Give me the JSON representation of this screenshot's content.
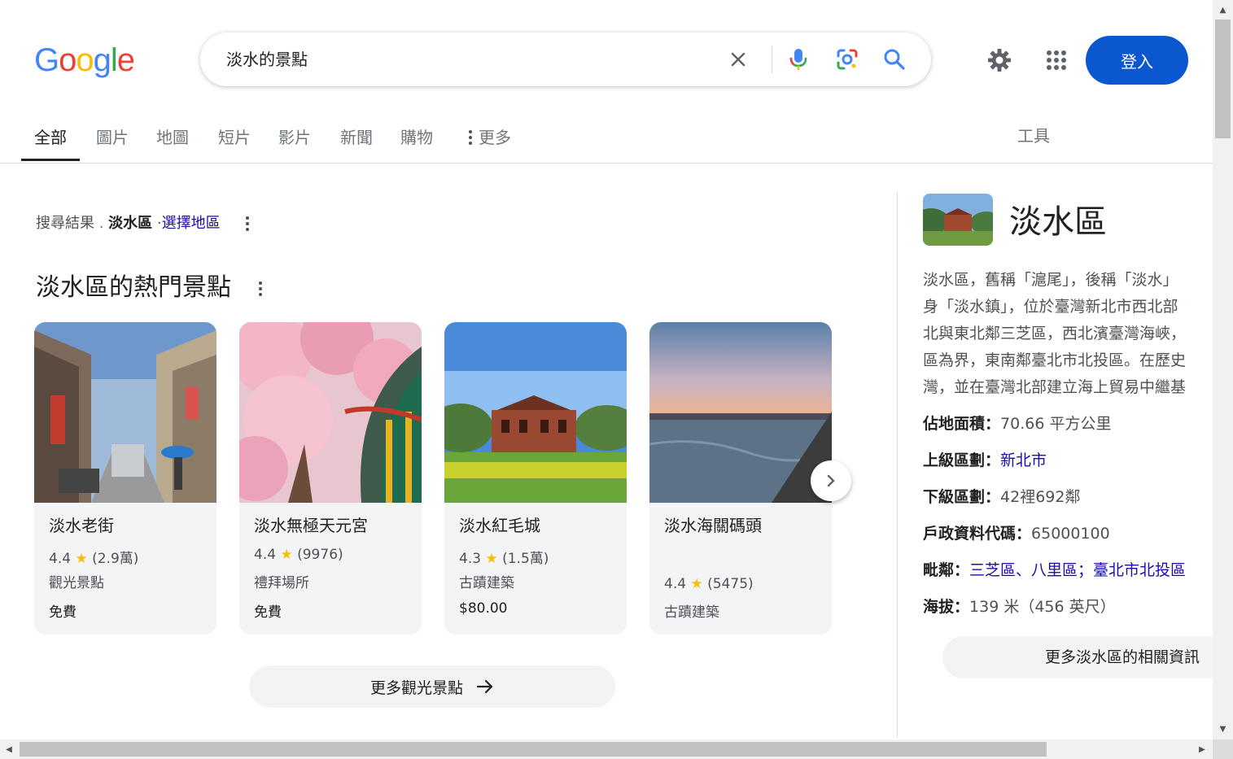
{
  "header": {
    "logo_letters": [
      "G",
      "o",
      "o",
      "g",
      "l",
      "e"
    ],
    "logo_colors": [
      "#4285f4",
      "#ea4335",
      "#fbbc05",
      "#4285f4",
      "#34a853",
      "#ea4335"
    ],
    "query": "淡水的景點",
    "icons": {
      "clear": "close-icon",
      "voice": "microphone-icon",
      "lens": "camera-lens-icon",
      "search": "search-icon",
      "settings": "gear-icon",
      "apps": "apps-grid-icon"
    },
    "sign_in": "登入"
  },
  "tabs": {
    "items": [
      "全部",
      "圖片",
      "地圖",
      "短片",
      "影片",
      "新聞",
      "購物"
    ],
    "active": "全部",
    "more": "更多",
    "tools": "工具"
  },
  "results": {
    "crumb_prefix": "搜尋結果",
    "crumb_place": "淡水區",
    "crumb_sep": "·",
    "crumb_link": "選擇地區",
    "heading": "淡水區的熱門景點",
    "cards": [
      {
        "title": "淡水老街",
        "rating": "4.4",
        "reviews": "(2.9萬)",
        "category": "觀光景點",
        "price": "免費"
      },
      {
        "title": "淡水無極天元宮",
        "rating": "4.4",
        "reviews": "(9976)",
        "category": "禮拜場所",
        "price": "免費"
      },
      {
        "title": "淡水紅毛城",
        "rating": "4.3",
        "reviews": "(1.5萬)",
        "category": "古蹟建築",
        "price": "$80.00"
      },
      {
        "title": "淡水海關碼頭",
        "rating": "4.4",
        "reviews": "(5475)",
        "category": "古蹟建築",
        "price": ""
      }
    ],
    "more_button": "更多觀光景點"
  },
  "knowledge_panel": {
    "title": "淡水區",
    "description_lines": [
      "淡水區，舊稱「滬尾」，後稱「淡水」",
      "身「淡水鎮」，位於臺灣新北市西北部",
      "北與東北鄰三芝區，西北濱臺灣海峽，",
      "區為界，東南鄰臺北市北投區。在歷史",
      "灣，並在臺灣北部建立海上貿易中繼基"
    ],
    "facts": {
      "area_label": "佔地面積：",
      "area_value": "70.66 平方公里",
      "parent_label": "上級區劃：",
      "parent_value": "新北市",
      "sub_label": "下級區劃：",
      "sub_value": "42裡692鄰",
      "code_label": "戶政資料代碼：",
      "code_value": "65000100",
      "adj_label": "毗鄰：",
      "adj_value": "三芝區、八里區；臺北市北投區",
      "elev_label": "海拔：",
      "elev_value": "139 米（456 英尺）"
    },
    "more_button": "更多淡水區的相關資訊"
  }
}
